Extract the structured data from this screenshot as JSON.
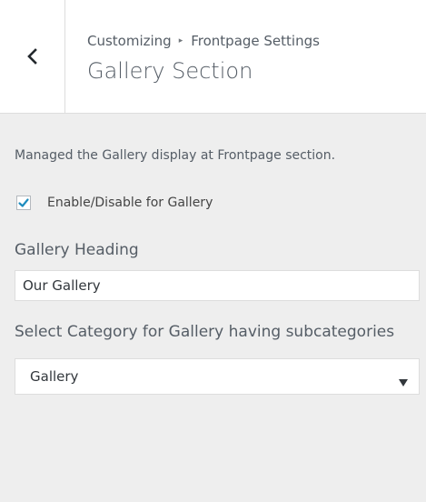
{
  "header": {
    "breadcrumb_root": "Customizing",
    "breadcrumb_separator": "▸",
    "breadcrumb_current": "Frontpage Settings",
    "title": "Gallery Section",
    "back_icon": "chevron-left-icon"
  },
  "section": {
    "description": "Managed the Gallery display at Frontpage section.",
    "enable_checkbox": {
      "label": "Enable/Disable for Gallery",
      "checked": true
    },
    "gallery_heading": {
      "label": "Gallery Heading",
      "value": "Our Gallery"
    },
    "category_select": {
      "label": "Select Category for Gallery having subcategories",
      "selected": "Gallery",
      "arrow_icon": "triangle-down-icon"
    }
  },
  "colors": {
    "panel_background": "#eeeeee",
    "header_background": "#ffffff",
    "border": "#dddddd",
    "accent": "#1e8cbe",
    "text": "#555d66"
  }
}
